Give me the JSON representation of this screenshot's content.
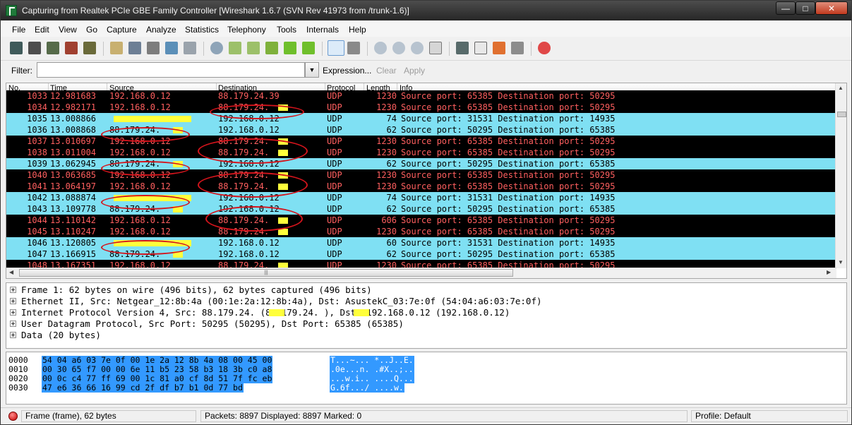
{
  "window": {
    "title": "Capturing from Realtek PCIe GBE Family Controller    [Wireshark 1.6.7  (SVN Rev 41973 from /trunk-1.6)]"
  },
  "menu": [
    "File",
    "Edit",
    "View",
    "Go",
    "Capture",
    "Analyze",
    "Statistics",
    "Telephony",
    "Tools",
    "Internals",
    "Help"
  ],
  "toolbar_icons": [
    "interface-list-icon",
    "capture-options-icon",
    "start-capture-icon",
    "stop-capture-icon",
    "restart-capture-icon",
    "open-file-icon",
    "save-file-icon",
    "close-file-icon",
    "reload-icon",
    "print-icon",
    "find-packet-icon",
    "go-back-icon",
    "go-forward-icon",
    "go-to-packet-icon",
    "go-first-icon",
    "go-last-icon",
    "colorize-icon",
    "autoscroll-icon",
    "zoom-in-icon",
    "zoom-out-icon",
    "zoom-normal-icon",
    "resize-columns-icon",
    "capture-filters-icon",
    "display-filters-icon",
    "coloring-rules-icon",
    "preferences-icon",
    "help-icon"
  ],
  "filter": {
    "label": "Filter:",
    "value": "",
    "expression": "Expression...",
    "clear": "Clear",
    "apply": "Apply"
  },
  "packet_list": {
    "columns": [
      "No.",
      "Time",
      "Source",
      "Destination",
      "Protocol",
      "Length",
      "Info"
    ],
    "rows": [
      {
        "no": "1033",
        "time": "12.981683",
        "src": "192.168.0.12",
        "dst": "88.179.24.39",
        "proto": "UDP",
        "len": "1230",
        "info": "Source port: 65385   Destination port: 50295",
        "style": "tcp"
      },
      {
        "no": "1034",
        "time": "12.982171",
        "src": "192.168.0.12",
        "dst": "88.179.24.",
        "proto": "UDP",
        "len": "1230",
        "info": "Source port: 65385   Destination port: 50295",
        "style": "tcp"
      },
      {
        "no": "1035",
        "time": "13.008866",
        "src": "",
        "dst": "192.168.0.12",
        "proto": "UDP",
        "len": "74",
        "info": "Source port: 31531   Destination port: 14935",
        "style": "in"
      },
      {
        "no": "1036",
        "time": "13.008868",
        "src": "88.179.24.",
        "dst": "192.168.0.12",
        "proto": "UDP",
        "len": "62",
        "info": "Source port: 50295   Destination port: 65385",
        "style": "in"
      },
      {
        "no": "1037",
        "time": "13.010697",
        "src": "192.168.0.12",
        "dst": "88.179.24.",
        "proto": "UDP",
        "len": "1230",
        "info": "Source port: 65385   Destination port: 50295",
        "style": "tcp"
      },
      {
        "no": "1038",
        "time": "13.011004",
        "src": "192.168.0.12",
        "dst": "88.179.24.",
        "proto": "UDP",
        "len": "1230",
        "info": "Source port: 65385   Destination port: 50295",
        "style": "tcp"
      },
      {
        "no": "1039",
        "time": "13.062945",
        "src": "88.179.24.",
        "dst": "192.168.0.12",
        "proto": "UDP",
        "len": "62",
        "info": "Source port: 50295   Destination port: 65385",
        "style": "in"
      },
      {
        "no": "1040",
        "time": "13.063685",
        "src": "192.168.0.12",
        "dst": "88.179.24.",
        "proto": "UDP",
        "len": "1230",
        "info": "Source port: 65385   Destination port: 50295",
        "style": "tcp"
      },
      {
        "no": "1041",
        "time": "13.064197",
        "src": "192.168.0.12",
        "dst": "88.179.24.",
        "proto": "UDP",
        "len": "1230",
        "info": "Source port: 65385   Destination port: 50295",
        "style": "tcp"
      },
      {
        "no": "1042",
        "time": "13.088874",
        "src": "",
        "dst": "192.168.0.12",
        "proto": "UDP",
        "len": "74",
        "info": "Source port: 31531   Destination port: 14935",
        "style": "in"
      },
      {
        "no": "1043",
        "time": "13.109778",
        "src": "88.179.24.",
        "dst": "192.168.0.12",
        "proto": "UDP",
        "len": "62",
        "info": "Source port: 50295   Destination port: 65385",
        "style": "in"
      },
      {
        "no": "1044",
        "time": "13.110142",
        "src": "192.168.0.12",
        "dst": "88.179.24.",
        "proto": "UDP",
        "len": "606",
        "info": "Source port: 65385   Destination port: 50295",
        "style": "tcp"
      },
      {
        "no": "1045",
        "time": "13.110247",
        "src": "192.168.0.12",
        "dst": "88.179.24.",
        "proto": "UDP",
        "len": "1230",
        "info": "Source port: 65385   Destination port: 50295",
        "style": "tcp"
      },
      {
        "no": "1046",
        "time": "13.120805",
        "src": "",
        "dst": "192.168.0.12",
        "proto": "UDP",
        "len": "60",
        "info": "Source port: 31531   Destination port: 14935",
        "style": "in"
      },
      {
        "no": "1047",
        "time": "13.166915",
        "src": "88.179.24.",
        "dst": "192.168.0.12",
        "proto": "UDP",
        "len": "62",
        "info": "Source port: 50295   Destination port: 65385",
        "style": "in"
      },
      {
        "no": "1048",
        "time": "13.167351",
        "src": "192.168.0.12",
        "dst": "88.179.24.",
        "proto": "UDP",
        "len": "1230",
        "info": "Source port: 65385   Destination port: 50295",
        "style": "tcp"
      }
    ]
  },
  "details": [
    "Frame 1: 62 bytes on wire (496 bits), 62 bytes captured (496 bits)",
    "Ethernet II, Src: Netgear_12:8b:4a (00:1e:2a:12:8b:4a), Dst: AsustekC_03:7e:0f (54:04:a6:03:7e:0f)",
    "Internet Protocol Version 4, Src: 88.179.24.    (88.179.24.    ), Dst: 192.168.0.12 (192.168.0.12)",
    "User Datagram Protocol, Src Port: 50295 (50295), Dst Port: 65385 (65385)",
    "Data (20 bytes)"
  ],
  "hex": [
    {
      "offset": "0000",
      "bytes": "54 04 a6 03 7e 0f 00 1e  2a 12 8b 4a 08 00 45 00",
      "ascii": "T...~... *..J..E."
    },
    {
      "offset": "0010",
      "bytes": "00 30 65 f7 00 00 6e 11  b5 23 58 b3 18 3b c0 a8",
      "ascii": ".0e...n. .#X..;.."
    },
    {
      "offset": "0020",
      "bytes": "00 0c c4 77 ff 69 00 1c  81 a0 cf 8d 51 7f fc eb",
      "ascii": "...w.i.. ....Q..."
    },
    {
      "offset": "0030",
      "bytes": "47 e6 36 66 16 99 cd 2f  df b7 b1 0d 77 bd",
      "ascii": "G.6f.../ ....w."
    }
  ],
  "status": {
    "frame": "Frame (frame), 62 bytes",
    "packets": "Packets: 8897 Displayed: 8897 Marked: 0",
    "profile": "Profile: Default"
  },
  "colors": {
    "outgoing_bg": "#000000",
    "outgoing_fg": "#ff5f5f",
    "incoming_bg": "#7fe0f3",
    "redaction": "#ffff3b",
    "annotation_ring": "#d4141c",
    "hex_selection": "#3399ff"
  }
}
